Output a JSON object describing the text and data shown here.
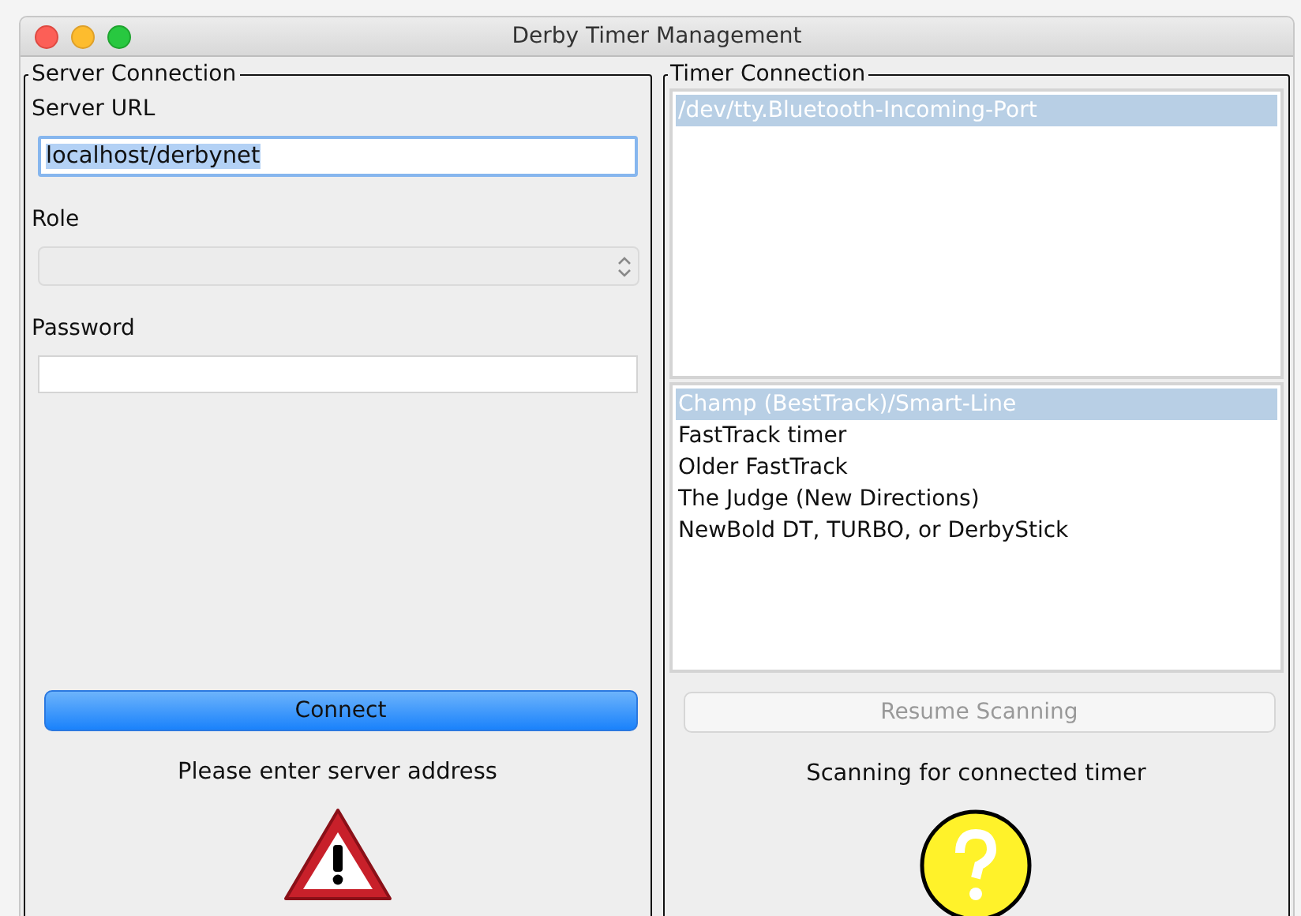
{
  "window": {
    "title": "Derby Timer Management"
  },
  "server_connection": {
    "legend": "Server Connection",
    "server_url": {
      "label": "Server URL",
      "value": "localhost/derbynet",
      "selected": true
    },
    "role": {
      "label": "Role",
      "disabled": true
    },
    "password": {
      "label": "Password"
    },
    "connect_button": {
      "label": "Connect",
      "disabled": false
    },
    "status": "Please enter server address",
    "status_icon": {
      "kind": "warning"
    }
  },
  "timer_connection": {
    "legend": "Timer Connection",
    "ports": [
      {
        "label": "/dev/tty.Bluetooth-Incoming-Port",
        "selected": true
      }
    ],
    "timer_types": [
      {
        "label": "Champ (BestTrack)/Smart-Line",
        "selected": true
      },
      {
        "label": "FastTrack timer",
        "selected": false
      },
      {
        "label": "Older FastTrack",
        "selected": false
      },
      {
        "label": "The Judge (New Directions)",
        "selected": false
      },
      {
        "label": "NewBold DT, TURBO, or DerbyStick",
        "selected": false
      }
    ],
    "resume_button": {
      "label": "Resume Scanning",
      "disabled": true
    },
    "status": "Scanning for connected timer",
    "status_icon": {
      "kind": "question"
    }
  }
}
